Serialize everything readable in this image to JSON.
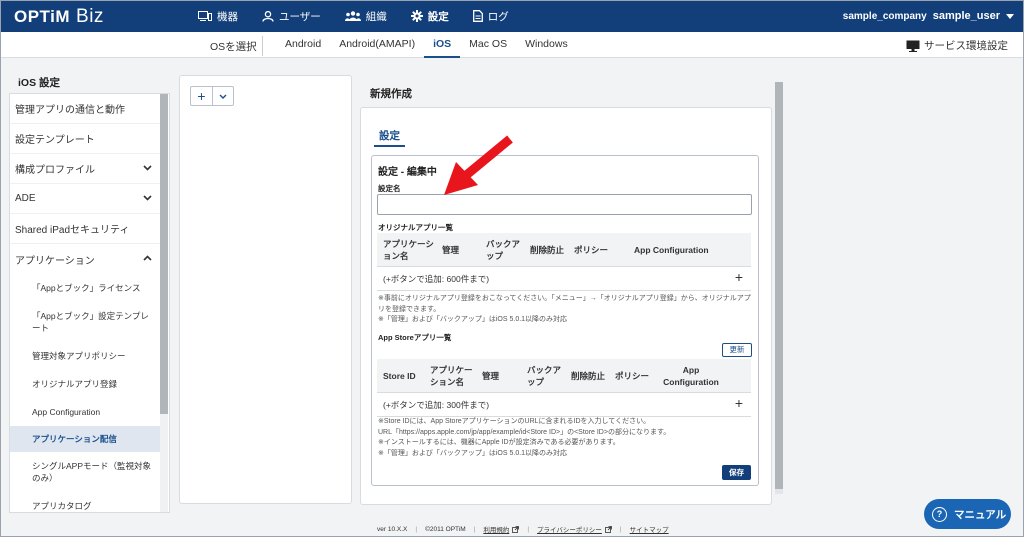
{
  "topbar": {
    "logo_main": "OPTiM",
    "logo_sub": "Biz",
    "nav": [
      {
        "label": "機器",
        "icon": "device-icon"
      },
      {
        "label": "ユーザー",
        "icon": "user-icon"
      },
      {
        "label": "組織",
        "icon": "organization-icon"
      },
      {
        "label": "設定",
        "icon": "gear-icon",
        "active": true
      },
      {
        "label": "ログ",
        "icon": "log-icon"
      }
    ],
    "company": "sample_company",
    "user": "sample_user"
  },
  "subbar": {
    "os_select_label": "OSを選択",
    "tabs": [
      "Android",
      "Android(AMAPI)",
      "iOS",
      "Mac OS",
      "Windows"
    ],
    "active_tab": "iOS",
    "service_settings": "サービス環境設定"
  },
  "sidebar": {
    "title": "iOS 設定",
    "items": [
      {
        "label": "管理アプリの通信と動作"
      },
      {
        "label": "設定テンプレート"
      },
      {
        "label": "構成プロファイル",
        "chevron": "down"
      },
      {
        "label": "ADE",
        "chevron": "down"
      },
      {
        "label": "Shared iPadセキュリティ"
      },
      {
        "label": "アプリケーション",
        "chevron": "up"
      }
    ],
    "subitems": [
      {
        "label": "「Appとブック」ライセンス"
      },
      {
        "label": "「Appとブック」設定テンプレート"
      },
      {
        "label": "管理対象アプリポリシー"
      },
      {
        "label": "オリジナルアプリ登録"
      },
      {
        "label": "App Configuration"
      },
      {
        "label": "アプリケーション配信",
        "active": true
      },
      {
        "label": "シングルAPPモード（監視対象のみ）"
      },
      {
        "label": "アプリカタログ"
      }
    ]
  },
  "main": {
    "title": "新規作成",
    "tab": "設定",
    "edit_heading": "設定 - 編集中",
    "name_label": "設定名",
    "name_value": "",
    "original_section": "オリジナルアプリ一覧",
    "original_columns": [
      "アプリケーション名",
      "管理",
      "バックアップ",
      "削除防止",
      "ポリシー",
      "App Configuration"
    ],
    "original_add_row": "(+ボタンで追加: 600件まで)",
    "original_notes": [
      "※事前にオリジナルアプリ登録をおこなってください。「メニュー」→「オリジナルアプリ登録」から、オリジナルアプリを登録できます。",
      "※「管理」および「バックアップ」はiOS 5.0.1以降のみ対応"
    ],
    "appstore_section": "App Storeアプリ一覧",
    "refresh_label": "更新",
    "appstore_columns": [
      "Store ID",
      "アプリケーション名",
      "管理",
      "バックアップ",
      "削除防止",
      "ポリシー",
      "App Configuration"
    ],
    "appstore_add_row": "(+ボタンで追加: 300件まで)",
    "appstore_notes": [
      "※Store IDには、App StoreアプリケーションのURLに含まれるIDを入力してください。",
      "URL「https://apps.apple.com/jp/app/example/id<Store ID>」の<Store ID>の部分になります。",
      "※インストールするには、機器にApple IDが設定済みである必要があります。",
      "※「管理」および「バックアップ」はiOS 5.0.1以降のみ対応"
    ],
    "save_label": "保存"
  },
  "footer": {
    "version": "ver 10.X.X",
    "copyright": "©2011 OPTiM",
    "terms": "利用規約",
    "privacy": "プライバシーポリシー",
    "sitemap": "サイトマップ"
  },
  "manual_button": "マニュアル",
  "colors": {
    "header": "#123f7a",
    "accent": "#1a4f8c",
    "manual": "#1a66b5",
    "arrow": "#e8161c"
  }
}
